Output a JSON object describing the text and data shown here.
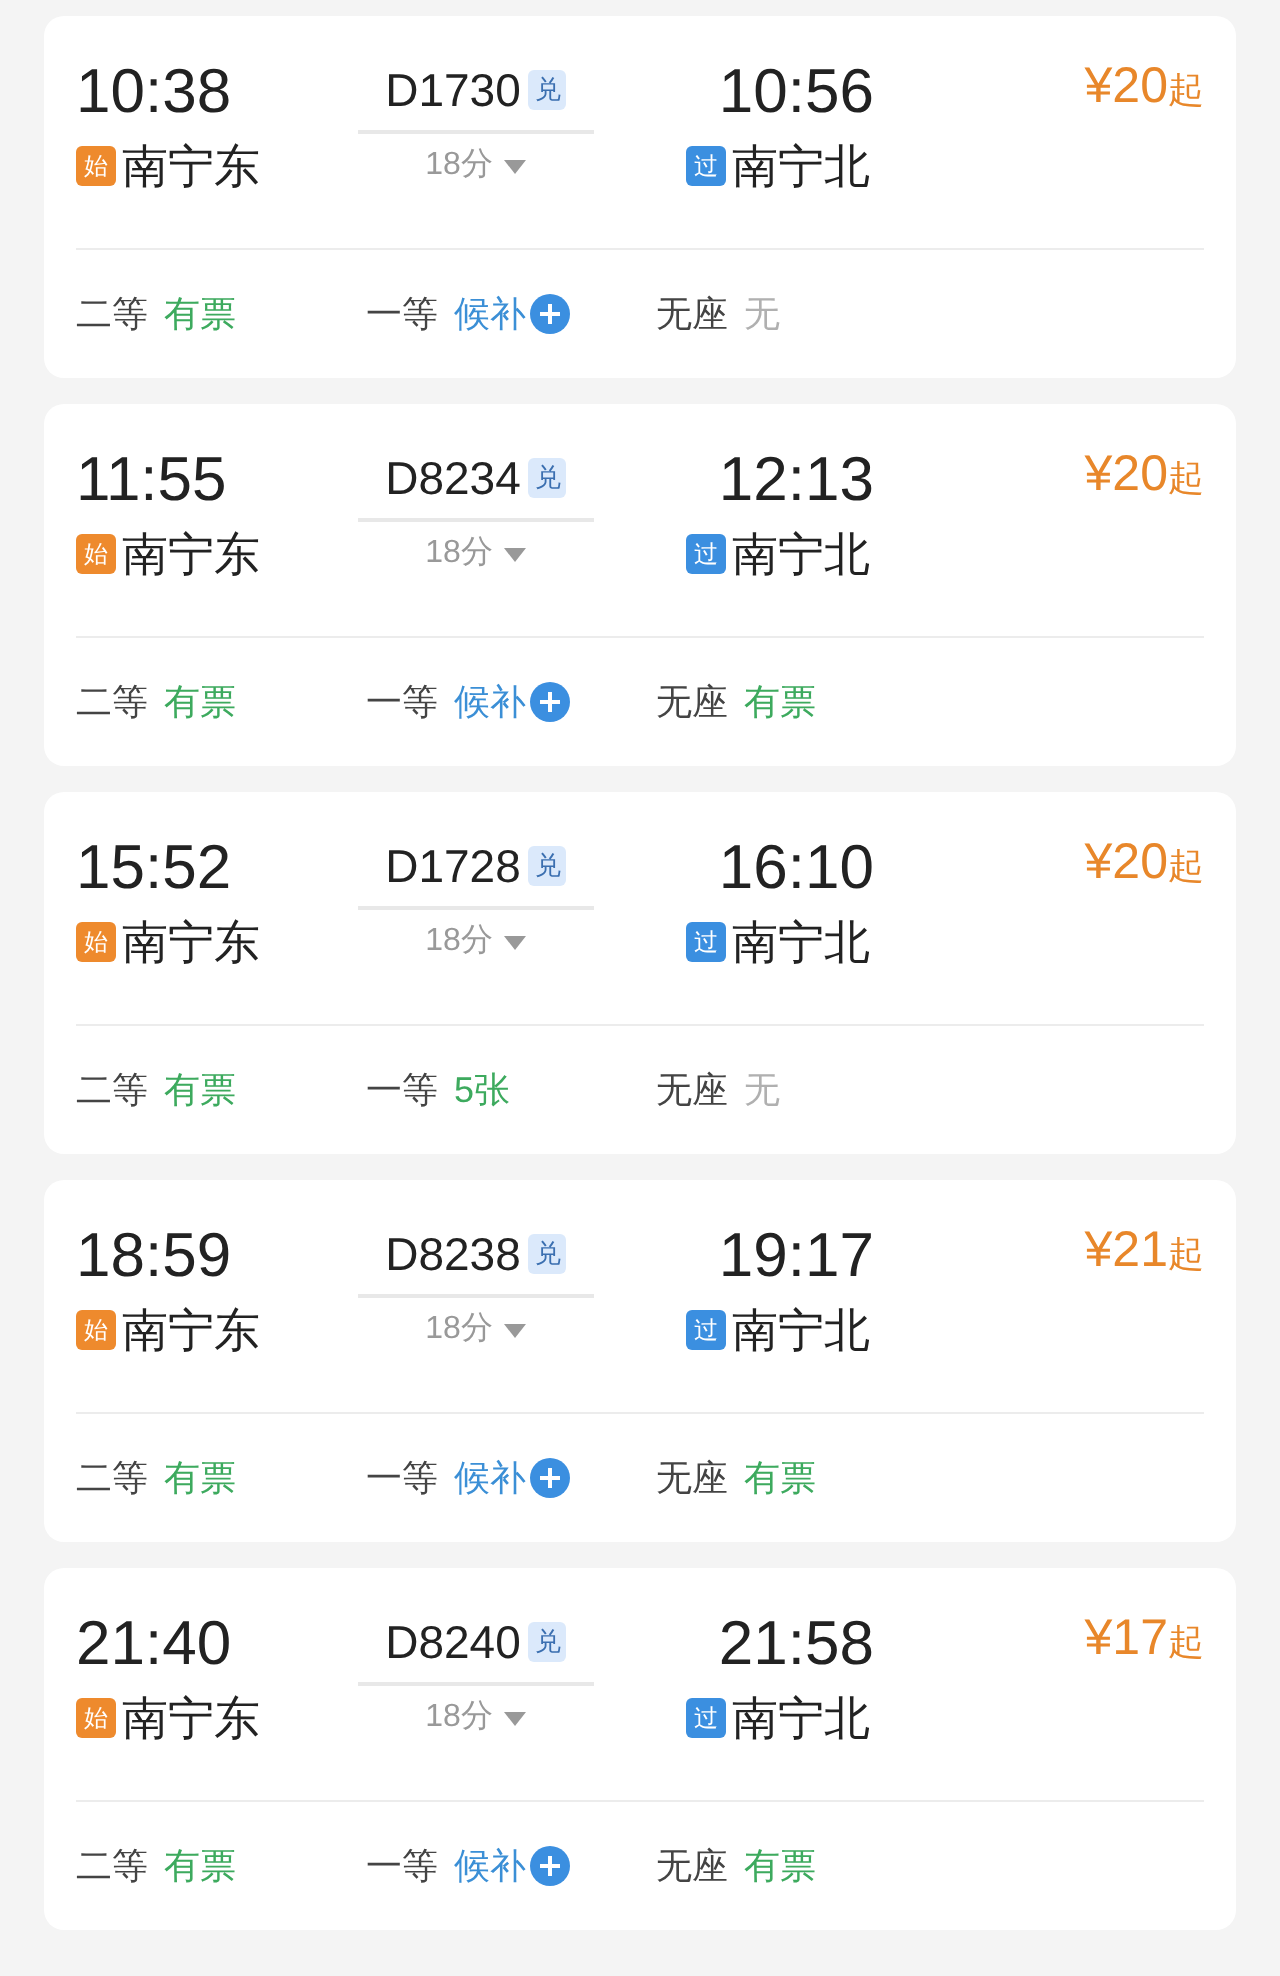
{
  "trains": [
    {
      "depart": "10:38",
      "from_tag": "始",
      "from": "南宁东",
      "train_no": "D1730",
      "train_tag": "兑",
      "duration": "18分",
      "arrive": "10:56",
      "to_tag": "过",
      "to": "南宁北",
      "price": "¥20",
      "price_suffix": "起",
      "seats": [
        {
          "class": "二等",
          "status": "有票",
          "kind": "available"
        },
        {
          "class": "一等",
          "status": "候补",
          "kind": "waitlist"
        },
        {
          "class": "无座",
          "status": "无",
          "kind": "none"
        }
      ]
    },
    {
      "depart": "11:55",
      "from_tag": "始",
      "from": "南宁东",
      "train_no": "D8234",
      "train_tag": "兑",
      "duration": "18分",
      "arrive": "12:13",
      "to_tag": "过",
      "to": "南宁北",
      "price": "¥20",
      "price_suffix": "起",
      "seats": [
        {
          "class": "二等",
          "status": "有票",
          "kind": "available"
        },
        {
          "class": "一等",
          "status": "候补",
          "kind": "waitlist"
        },
        {
          "class": "无座",
          "status": "有票",
          "kind": "available"
        }
      ]
    },
    {
      "depart": "15:52",
      "from_tag": "始",
      "from": "南宁东",
      "train_no": "D1728",
      "train_tag": "兑",
      "duration": "18分",
      "arrive": "16:10",
      "to_tag": "过",
      "to": "南宁北",
      "price": "¥20",
      "price_suffix": "起",
      "seats": [
        {
          "class": "二等",
          "status": "有票",
          "kind": "available"
        },
        {
          "class": "一等",
          "status": "5张",
          "kind": "available"
        },
        {
          "class": "无座",
          "status": "无",
          "kind": "none"
        }
      ]
    },
    {
      "depart": "18:59",
      "from_tag": "始",
      "from": "南宁东",
      "train_no": "D8238",
      "train_tag": "兑",
      "duration": "18分",
      "arrive": "19:17",
      "to_tag": "过",
      "to": "南宁北",
      "price": "¥21",
      "price_suffix": "起",
      "seats": [
        {
          "class": "二等",
          "status": "有票",
          "kind": "available"
        },
        {
          "class": "一等",
          "status": "候补",
          "kind": "waitlist"
        },
        {
          "class": "无座",
          "status": "有票",
          "kind": "available"
        }
      ]
    },
    {
      "depart": "21:40",
      "from_tag": "始",
      "from": "南宁东",
      "train_no": "D8240",
      "train_tag": "兑",
      "duration": "18分",
      "arrive": "21:58",
      "to_tag": "过",
      "to": "南宁北",
      "price": "¥17",
      "price_suffix": "起",
      "seats": [
        {
          "class": "二等",
          "status": "有票",
          "kind": "available"
        },
        {
          "class": "一等",
          "status": "候补",
          "kind": "waitlist"
        },
        {
          "class": "无座",
          "status": "有票",
          "kind": "available"
        }
      ]
    }
  ]
}
